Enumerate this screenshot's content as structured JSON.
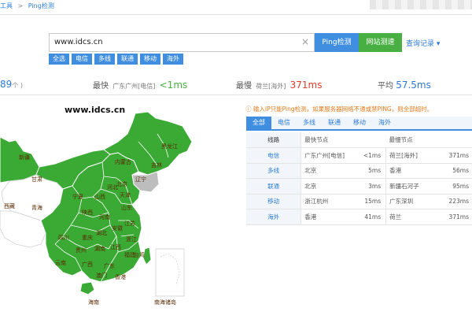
{
  "breadcrumb": {
    "items": [
      "工具",
      ">",
      "Ping检测"
    ]
  },
  "search": {
    "value": "www.idcs.cn",
    "clear_icon": "close-icon"
  },
  "buttons": {
    "ping": "Ping检测",
    "speed": "网站测速",
    "history": "查询记录",
    "history_arrow": "▾"
  },
  "chips": [
    "全选",
    "电信",
    "多线",
    "联通",
    "移动",
    "海外"
  ],
  "stats": {
    "count_value": "89",
    "count_unit": "个 )",
    "fastest_label": "最快",
    "fastest_node": "广东广州[电信]",
    "fastest_value": "<1ms",
    "slowest_label": "最慢",
    "slowest_node": "荷兰[海外]",
    "slowest_value": "371ms",
    "average_label": "平均",
    "average_value": "57.5ms"
  },
  "map": {
    "title": "www.idcs.cn",
    "labels": [
      "新疆",
      "甘肃",
      "青海",
      "西藏",
      "四川",
      "云南",
      "宁夏",
      "陕西",
      "重庆",
      "贵州",
      "广西",
      "湖南",
      "湖北",
      "河南",
      "山西",
      "河北",
      "北京",
      "天津",
      "山东",
      "辽宁",
      "吉林",
      "黑龙江",
      "内蒙古",
      "江苏",
      "安徽",
      "浙江",
      "江西",
      "福建",
      "广东",
      "香港",
      "澳门",
      "海南",
      "台湾",
      "南海诸岛"
    ]
  },
  "notice": "输入IP只能Ping检测，如果服务器网络不通或禁PING，则全部超时。",
  "tabs": [
    "全部",
    "电信",
    "多线",
    "联通",
    "移动",
    "海外"
  ],
  "table": {
    "headers": {
      "line": "线路",
      "fast_node": "最快节点",
      "slow_node": "最慢节点"
    },
    "rows": [
      {
        "line": "电信",
        "fast_node": "广东广州[电信]",
        "fast_ms": "<1ms",
        "slow_node": "荷兰[海外]",
        "slow_ms": "371ms"
      },
      {
        "line": "多线",
        "fast_node": "北京",
        "fast_ms": "5ms",
        "slow_node": "香港",
        "slow_ms": "56ms"
      },
      {
        "line": "联通",
        "fast_node": "北京",
        "fast_ms": "3ms",
        "slow_node": "新疆石河子",
        "slow_ms": "95ms"
      },
      {
        "line": "移动",
        "fast_node": "浙江杭州",
        "fast_ms": "15ms",
        "slow_node": "广东深圳",
        "slow_ms": "223ms"
      },
      {
        "line": "海外",
        "fast_node": "香港",
        "fast_ms": "41ms",
        "slow_node": "荷兰",
        "slow_ms": "371ms"
      }
    ]
  },
  "colors": {
    "accent_blue": "#3f8ee0",
    "success_green": "#48b043",
    "danger_red": "#e03b2c",
    "map_green": "#3aaa35",
    "map_gray": "#bdbdbd"
  }
}
